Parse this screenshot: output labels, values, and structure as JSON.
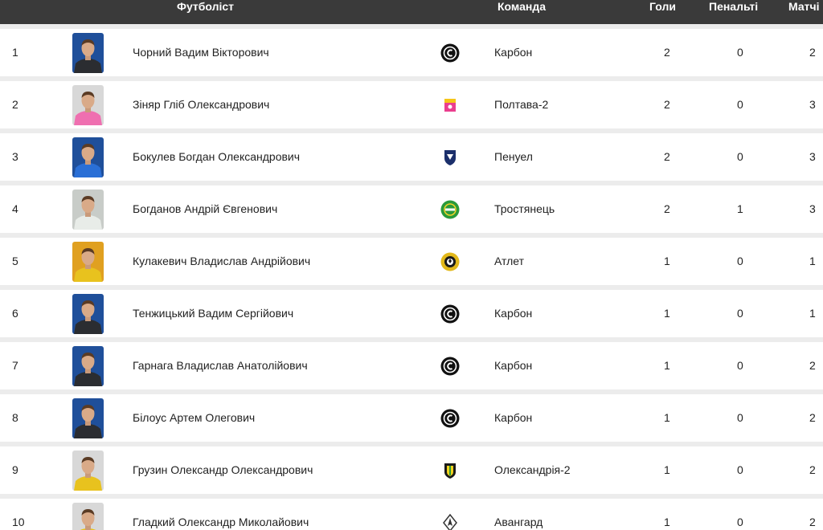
{
  "header": {
    "player": "Футболіст",
    "team": "Команда",
    "goals": "Голи",
    "penalties": "Пенальті",
    "matches": "Матчі"
  },
  "rows": [
    {
      "rank": "1",
      "name": "Чорний Вадим Вікторович",
      "team": "Карбон",
      "goals": "2",
      "penalties": "0",
      "matches": "2",
      "logo": "karbon-logo-icon",
      "kit": "#2b2d31",
      "bg": "#1f4f9a"
    },
    {
      "rank": "2",
      "name": "Зіняр Гліб Олександрович",
      "team": "Полтава-2",
      "goals": "2",
      "penalties": "0",
      "matches": "3",
      "logo": "poltava-logo-icon",
      "kit": "#ef6fb0",
      "bg": "#d8d8d8"
    },
    {
      "rank": "3",
      "name": "Бокулев Богдан Олександрович",
      "team": "Пенуел",
      "goals": "2",
      "penalties": "0",
      "matches": "3",
      "logo": "penuel-logo-icon",
      "kit": "#2a6fd6",
      "bg": "#1f4f9a"
    },
    {
      "rank": "4",
      "name": "Богданов Андрій Євгенович",
      "team": "Тростянець",
      "goals": "2",
      "penalties": "1",
      "matches": "3",
      "logo": "trostianets-logo-icon",
      "kit": "#e8ece8",
      "bg": "#c8ccc8"
    },
    {
      "rank": "5",
      "name": "Кулакевич Владислав Андрійович",
      "team": "Атлет",
      "goals": "1",
      "penalties": "0",
      "matches": "1",
      "logo": "atlet-logo-icon",
      "kit": "#e8c21e",
      "bg": "#e0a020"
    },
    {
      "rank": "6",
      "name": "Тенжицький Вадим Сергійович",
      "team": "Карбон",
      "goals": "1",
      "penalties": "0",
      "matches": "1",
      "logo": "karbon-logo-icon",
      "kit": "#2b2d31",
      "bg": "#1f4f9a"
    },
    {
      "rank": "7",
      "name": "Гарнага Владислав Анатолійович",
      "team": "Карбон",
      "goals": "1",
      "penalties": "0",
      "matches": "2",
      "logo": "karbon-logo-icon",
      "kit": "#2b2d31",
      "bg": "#1f4f9a"
    },
    {
      "rank": "8",
      "name": "Білоус Артем Олегович",
      "team": "Карбон",
      "goals": "1",
      "penalties": "0",
      "matches": "2",
      "logo": "karbon-logo-icon",
      "kit": "#2b2d31",
      "bg": "#1f4f9a"
    },
    {
      "rank": "9",
      "name": "Грузин Олександр Олександрович",
      "team": "Олександрія-2",
      "goals": "1",
      "penalties": "0",
      "matches": "2",
      "logo": "oleksandriia-logo-icon",
      "kit": "#e8c21e",
      "bg": "#d8d8d8"
    },
    {
      "rank": "10",
      "name": "Гладкий Олександр Миколайович",
      "team": "Авангард",
      "goals": "1",
      "penalties": "0",
      "matches": "2",
      "logo": "avanhard-logo-icon",
      "kit": "#e8c21e",
      "bg": "#d8d8d8"
    }
  ]
}
